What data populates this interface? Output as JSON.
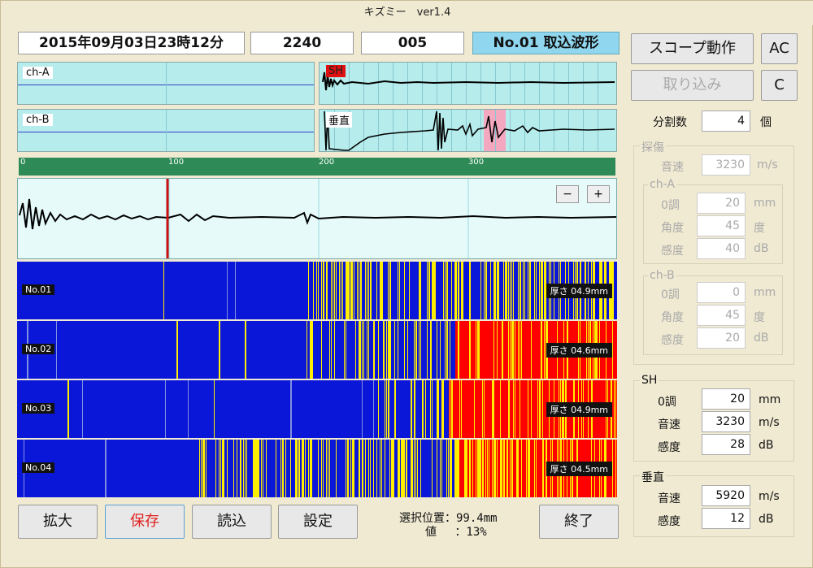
{
  "window": {
    "title": "キズミー　ver1.4"
  },
  "header": {
    "datetime": "2015年09月03日23時12分",
    "value1": "2240",
    "value2": "005",
    "mode": "No.01 取込波形"
  },
  "scopes": {
    "ch_a": "ch-A",
    "ch_b": "ch-B",
    "sh_tag": "SH",
    "vertical_tag": "垂直"
  },
  "ruler": {
    "ticks": [
      "0",
      "100",
      "200",
      "300"
    ]
  },
  "zoom": {
    "minus": "−",
    "plus": "+"
  },
  "strips": [
    {
      "label": "No.01",
      "thickness": "厚さ 04.9mm"
    },
    {
      "label": "No.02",
      "thickness": "厚さ 04.6mm"
    },
    {
      "label": "No.03",
      "thickness": "厚さ 04.9mm"
    },
    {
      "label": "No.04",
      "thickness": "厚さ 04.5mm"
    }
  ],
  "buttons": {
    "scope": "スコープ動作",
    "ac": "AC",
    "capture": "取り込み",
    "c": "C",
    "expand": "拡大",
    "save": "保存",
    "load": "読込",
    "settings": "設定",
    "exit": "終了"
  },
  "divisions": {
    "label": "分割数",
    "value": "4",
    "unit": "個"
  },
  "flaw": {
    "title": "探傷",
    "speed_label": "音速",
    "speed": "3230",
    "speed_unit": "m/s",
    "ch_a": {
      "title": "ch-A",
      "zero_label": "0調",
      "zero": "20",
      "zero_unit": "mm",
      "angle_label": "角度",
      "angle": "45",
      "angle_unit": "度",
      "sens_label": "感度",
      "sens": "40",
      "sens_unit": "dB"
    },
    "ch_b": {
      "title": "ch-B",
      "zero_label": "0調",
      "zero": "0",
      "zero_unit": "mm",
      "angle_label": "角度",
      "angle": "45",
      "angle_unit": "度",
      "sens_label": "感度",
      "sens": "20",
      "sens_unit": "dB"
    }
  },
  "sh": {
    "title": "SH",
    "zero_label": "0調",
    "zero": "20",
    "zero_unit": "mm",
    "speed_label": "音速",
    "speed": "3230",
    "speed_unit": "m/s",
    "sens_label": "感度",
    "sens": "28",
    "sens_unit": "dB"
  },
  "vertical": {
    "title": "垂直",
    "speed_label": "音速",
    "speed": "5920",
    "speed_unit": "m/s",
    "sens_label": "感度",
    "sens": "12",
    "sens_unit": "dB"
  },
  "status": {
    "pos_label": "選択位置：99.4mm",
    "val_label": "値　 ：13%"
  },
  "colors": {
    "blue": "#0a16d8",
    "yellow": "#ffee00",
    "red": "#ff0000",
    "scope_bg": "#b6ecec"
  }
}
